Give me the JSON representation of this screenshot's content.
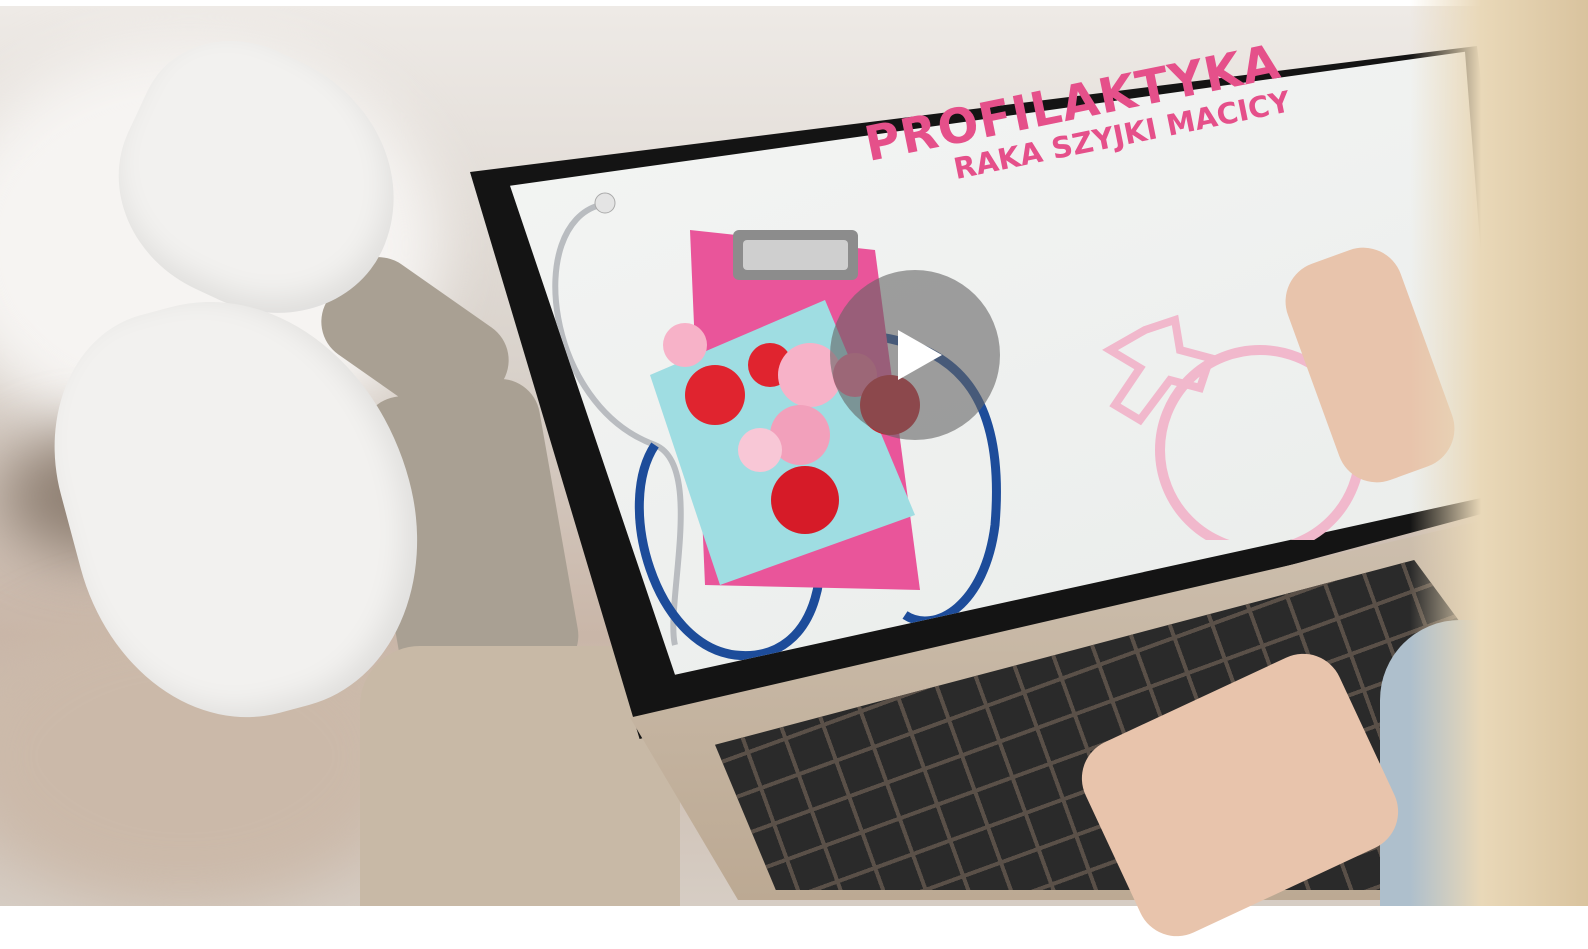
{
  "screen_title": "PROFILAKTYKA",
  "screen_subtitle": "RAKA SZYJKI MACICY",
  "colors": {
    "accent_pink": "#e5508a",
    "laptop_bezel": "#141414",
    "laptop_body": "#c8b8a4"
  },
  "icons": {
    "play": "play-icon",
    "venus": "venus-symbol-icon"
  }
}
